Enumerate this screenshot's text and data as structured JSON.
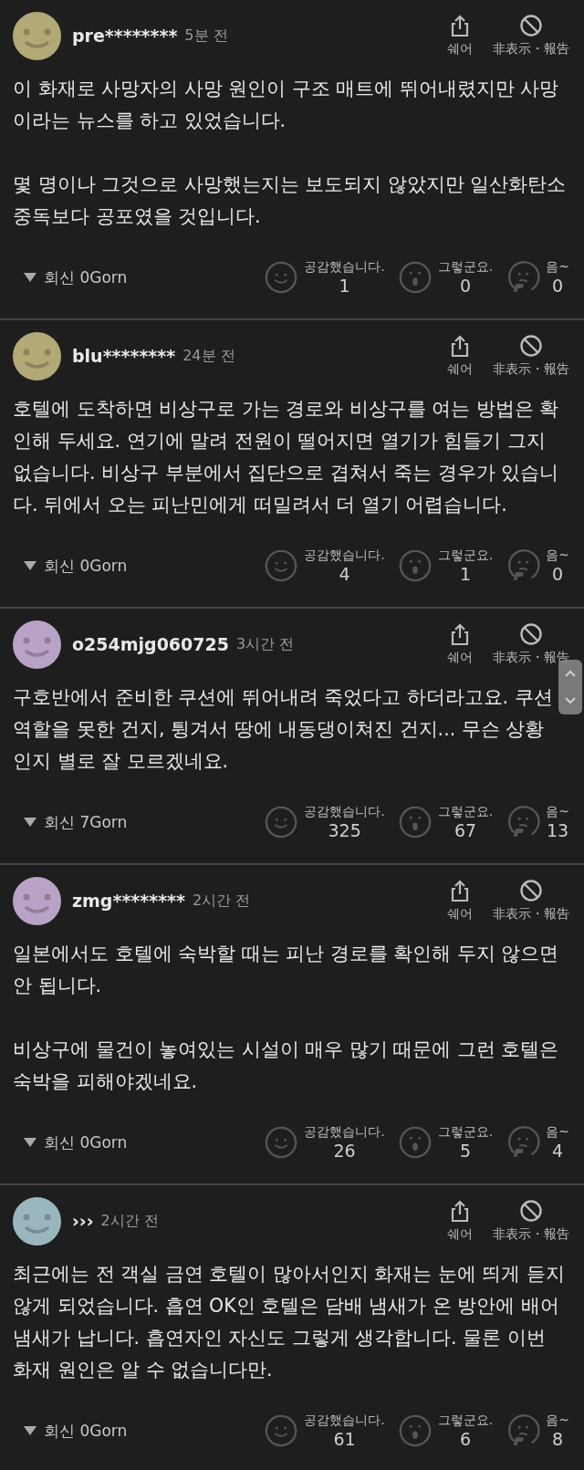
{
  "comments": [
    {
      "username": "pre********",
      "time": "5분 전",
      "color": "#b3a977",
      "share_label": "쉐어",
      "hide_label": "非表示・報告",
      "paragraphs": [
        "이 화재로 사망자의 사망 원인이 구조 매트에 뛰어내렸지만 사망이라는 뉴스를 하고 있었습니다.",
        "몇 명이나 그것으로 사망했는지는 보도되지 않았지만 일산화탄소 중독보다 공포였을 것입니다."
      ],
      "reply": "회신 0Gorn",
      "reactions": [
        {
          "kind": "smile",
          "label": "공감했습니다.",
          "count": "1"
        },
        {
          "kind": "surprised",
          "label": "그렇군요.",
          "count": "0"
        },
        {
          "kind": "thinking",
          "label": "음~",
          "count": "0"
        }
      ]
    },
    {
      "username": "blu********",
      "time": "24분 전",
      "color": "#b3a977",
      "share_label": "쉐어",
      "hide_label": "非表示・報告",
      "paragraphs": [
        "호텔에 도착하면 비상구로 가는 경로와 비상구를 여는 방법은 확인해 두세요. 연기에 말려 전원이 떨어지면 열기가 힘들기 그지 없습니다. 비상구 부분에서 집단으로 겹쳐서 죽는 경우가 있습니다. 뒤에서 오는 피난민에게 떠밀려서 더 열기 어렵습니다."
      ],
      "reply": "회신 0Gorn",
      "reactions": [
        {
          "kind": "smile",
          "label": "공감했습니다.",
          "count": "4"
        },
        {
          "kind": "surprised",
          "label": "그렇군요.",
          "count": "1"
        },
        {
          "kind": "thinking",
          "label": "음~",
          "count": "0"
        }
      ]
    },
    {
      "username": "o254mjg060725",
      "time": "3시간 전",
      "color": "#b8a3c6",
      "share_label": "쉐어",
      "hide_label": "非表示・報告",
      "scroll_button": true,
      "paragraphs": [
        "구호반에서 준비한 쿠션에 뛰어내려 죽었다고 하더라고요. 쿠션 역할을 못한 건지, 튕겨서 땅에 내동댕이쳐진 건지... 무슨 상황인지 별로 잘 모르겠네요."
      ],
      "reply": "회신 7Gorn",
      "reactions": [
        {
          "kind": "smile",
          "label": "공감했습니다.",
          "count": "325"
        },
        {
          "kind": "surprised",
          "label": "그렇군요.",
          "count": "67"
        },
        {
          "kind": "thinking",
          "label": "음~",
          "count": "13"
        }
      ]
    },
    {
      "username": "zmg********",
      "time": "2시간 전",
      "color": "#b8a3c6",
      "share_label": "쉐어",
      "hide_label": "非表示・報告",
      "paragraphs": [
        "일본에서도 호텔에 숙박할 때는 피난 경로를 확인해 두지 않으면 안 됩니다.",
        "비상구에 물건이 놓여있는 시설이 매우 많기 때문에 그런 호텔은 숙박을 피해야겠네요."
      ],
      "reply": "회신 0Gorn",
      "reactions": [
        {
          "kind": "smile",
          "label": "공감했습니다.",
          "count": "26"
        },
        {
          "kind": "surprised",
          "label": "그렇군요.",
          "count": "5"
        },
        {
          "kind": "thinking",
          "label": "음~",
          "count": "4"
        }
      ]
    },
    {
      "username": "›››",
      "time": "2시간 전",
      "color": "#9ab7c0",
      "share_label": "쉐어",
      "hide_label": "非表示・報告",
      "paragraphs": [
        "최근에는 전 객실 금연 호텔이 많아서인지 화재는 눈에 띄게 듣지 않게 되었습니다. 흡연 OK인 호텔은 담배 냄새가 온 방안에 배어 냄새가 납니다. 흡연자인 자신도 그렇게 생각합니다. 물론 이번 화재 원인은 알 수 없습니다만."
      ],
      "reply": "회신 0Gorn",
      "reactions": [
        {
          "kind": "smile",
          "label": "공감했습니다.",
          "count": "61"
        },
        {
          "kind": "surprised",
          "label": "그렇군요.",
          "count": "6"
        },
        {
          "kind": "thinking",
          "label": "음~",
          "count": "8"
        }
      ]
    }
  ]
}
